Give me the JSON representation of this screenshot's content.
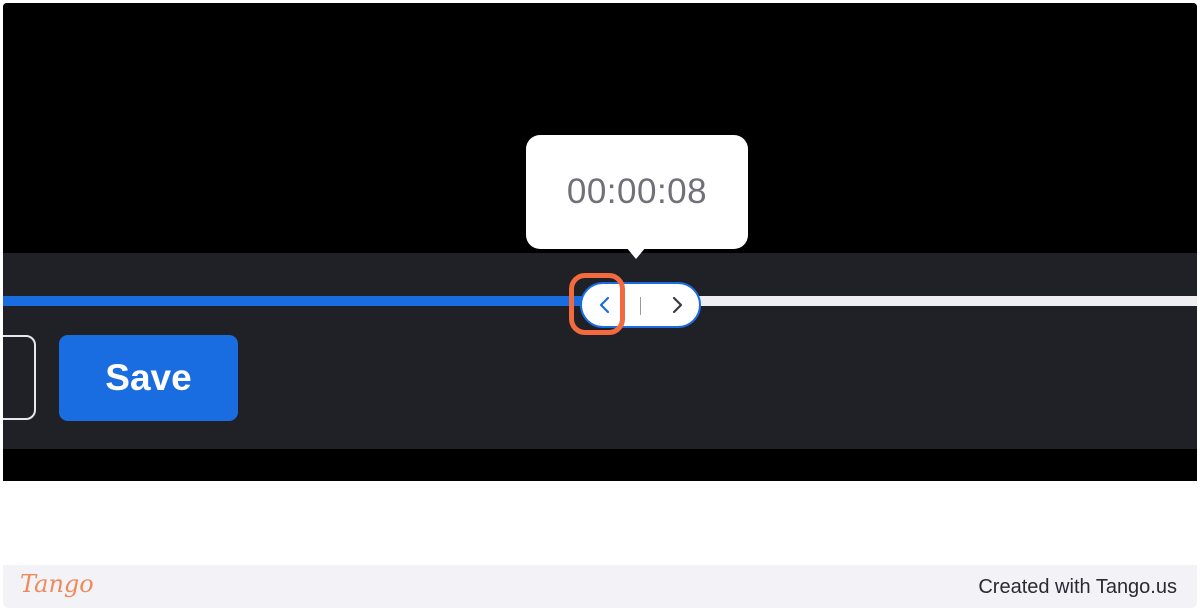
{
  "timeline": {
    "tooltip_time": "00:00:08",
    "played_fraction": 0.49
  },
  "trim_handle": {
    "left_icon": "chevron-left-icon",
    "right_icon": "chevron-right-icon"
  },
  "actions": {
    "save_label": "Save"
  },
  "footer": {
    "logo_text": "Tango",
    "credit": "Created with Tango.us"
  },
  "colors": {
    "accent": "#1a6de0",
    "highlight": "#f26a3d",
    "panel": "#202027",
    "logo": "#f08a5d"
  }
}
